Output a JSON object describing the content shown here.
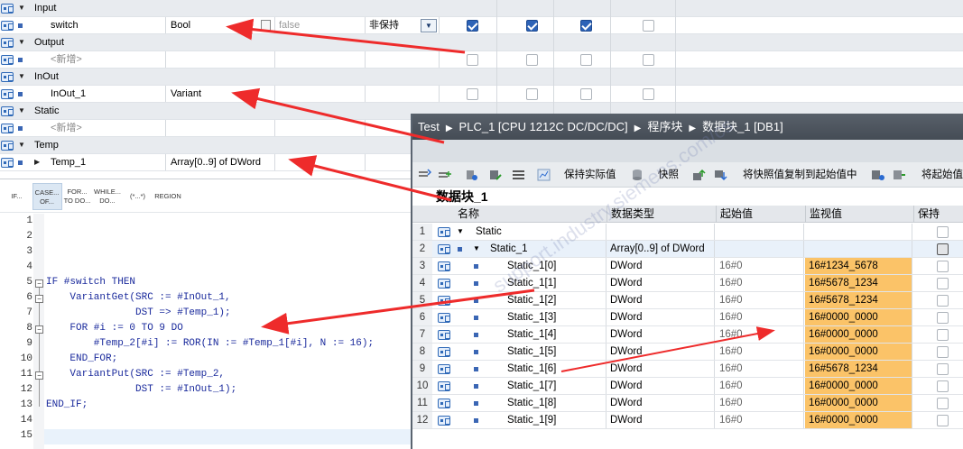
{
  "interface": {
    "rows": [
      {
        "kind": "section",
        "name": "Input"
      },
      {
        "kind": "var",
        "name": "switch",
        "type": "Bool",
        "default": "false",
        "retain": "非保持",
        "checks": [
          true,
          true,
          true,
          false
        ]
      },
      {
        "kind": "section",
        "name": "Output"
      },
      {
        "kind": "new",
        "name": "<新增>",
        "checks": [
          false,
          false,
          false,
          false
        ]
      },
      {
        "kind": "section",
        "name": "InOut"
      },
      {
        "kind": "var",
        "name": "InOut_1",
        "type": "Variant",
        "checks": [
          false,
          false,
          false,
          false
        ]
      },
      {
        "kind": "section",
        "name": "Static"
      },
      {
        "kind": "new",
        "name": "<新增>",
        "checks": [
          false,
          false,
          false,
          false
        ]
      },
      {
        "kind": "section",
        "name": "Temp"
      },
      {
        "kind": "var",
        "name": "Temp_1",
        "type": "Array[0..9] of DWord",
        "expandable": true,
        "checks": [
          false,
          false,
          false,
          false
        ]
      }
    ]
  },
  "toolbar": {
    "buttons": [
      {
        "id": "if",
        "label": "IF..."
      },
      {
        "id": "case",
        "label": "CASE... OF..."
      },
      {
        "id": "for",
        "label": "FOR... TO DO..."
      },
      {
        "id": "while",
        "label": "WHILE... DO..."
      },
      {
        "id": "comment",
        "label": "(*...*)"
      },
      {
        "id": "region",
        "label": "REGION"
      }
    ]
  },
  "code": {
    "lines": [
      {
        "n": "1",
        "text": ""
      },
      {
        "n": "2",
        "text": ""
      },
      {
        "n": "3",
        "text": ""
      },
      {
        "n": "4",
        "text": ""
      },
      {
        "n": "5",
        "text": "IF #switch THEN"
      },
      {
        "n": "6",
        "text": "    VariantGet(SRC := #InOut_1,"
      },
      {
        "n": "7",
        "text": "               DST => #Temp_1);"
      },
      {
        "n": "8",
        "text": "    FOR #i := 0 TO 9 DO"
      },
      {
        "n": "9",
        "text": "        #Temp_2[#i] := ROR(IN := #Temp_1[#i], N := 16);"
      },
      {
        "n": "10",
        "text": "    END_FOR;"
      },
      {
        "n": "11",
        "text": "    VariantPut(SRC := #Temp_2,"
      },
      {
        "n": "12",
        "text": "               DST := #InOut_1);"
      },
      {
        "n": "13",
        "text": "END_IF;"
      },
      {
        "n": "14",
        "text": ""
      },
      {
        "n": "15",
        "text": ""
      }
    ]
  },
  "db": {
    "breadcrumb": [
      "Test",
      "PLC_1 [CPU 1212C DC/DC/DC]",
      "程序块",
      "数据块_1 [DB1]"
    ],
    "tools": {
      "keep_actual": "保持实际值",
      "snapshot": "快照",
      "copy_snapshot": "将快照值复制到起始值中",
      "copy_start": "将起始值"
    },
    "block_name": "数据块_1",
    "headers": {
      "name": "名称",
      "type": "数据类型",
      "start": "起始值",
      "monitor": "监视值",
      "retain": "保持"
    },
    "rows": [
      {
        "n": "1",
        "name": "Static",
        "type": "",
        "start": "",
        "monitor": "",
        "level": 0
      },
      {
        "n": "2",
        "name": "Static_1",
        "type": "Array[0..9] of DWord",
        "start": "",
        "monitor": "",
        "level": 1
      },
      {
        "n": "3",
        "name": "Static_1[0]",
        "type": "DWord",
        "start": "16#0",
        "monitor": "16#1234_5678",
        "level": 2
      },
      {
        "n": "4",
        "name": "Static_1[1]",
        "type": "DWord",
        "start": "16#0",
        "monitor": "16#5678_1234",
        "level": 2
      },
      {
        "n": "5",
        "name": "Static_1[2]",
        "type": "DWord",
        "start": "16#0",
        "monitor": "16#5678_1234",
        "level": 2
      },
      {
        "n": "6",
        "name": "Static_1[3]",
        "type": "DWord",
        "start": "16#0",
        "monitor": "16#0000_0000",
        "level": 2
      },
      {
        "n": "7",
        "name": "Static_1[4]",
        "type": "DWord",
        "start": "16#0",
        "monitor": "16#0000_0000",
        "level": 2
      },
      {
        "n": "8",
        "name": "Static_1[5]",
        "type": "DWord",
        "start": "16#0",
        "monitor": "16#0000_0000",
        "level": 2
      },
      {
        "n": "9",
        "name": "Static_1[6]",
        "type": "DWord",
        "start": "16#0",
        "monitor": "16#5678_1234",
        "level": 2
      },
      {
        "n": "10",
        "name": "Static_1[7]",
        "type": "DWord",
        "start": "16#0",
        "monitor": "16#0000_0000",
        "level": 2
      },
      {
        "n": "11",
        "name": "Static_1[8]",
        "type": "DWord",
        "start": "16#0",
        "monitor": "16#0000_0000",
        "level": 2
      },
      {
        "n": "12",
        "name": "Static_1[9]",
        "type": "DWord",
        "start": "16#0",
        "monitor": "16#0000_0000",
        "level": 2
      }
    ]
  },
  "colors": {
    "accent": "#2d63b7",
    "highlight": "#fbc368",
    "arrow": "#ee2b2b",
    "title_bar": "#4e565f"
  }
}
